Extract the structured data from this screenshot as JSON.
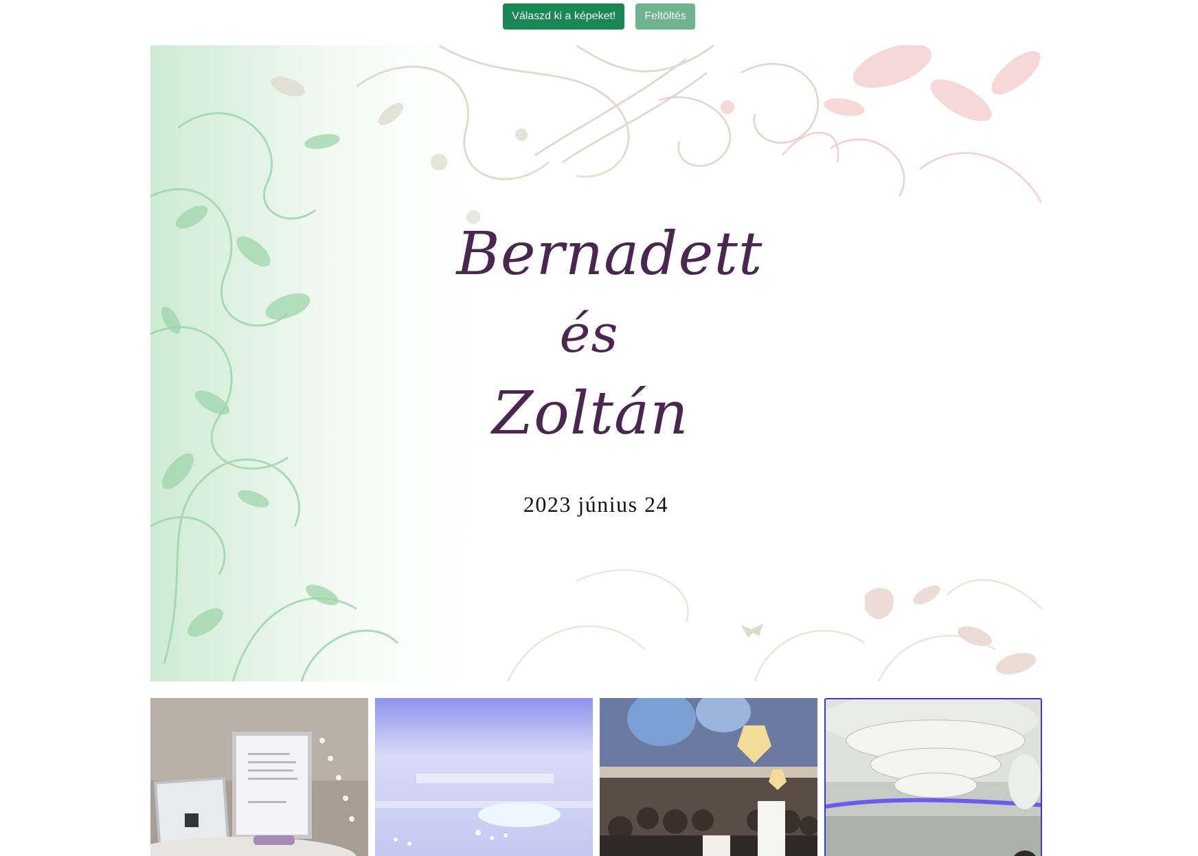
{
  "toolbar": {
    "choose_label": "Válaszd ki a képeket!",
    "upload_label": "Feltöltés"
  },
  "hero": {
    "name_bride": "Bernadett",
    "name_and": "és",
    "name_groom": "Zoltán",
    "date": "2023 június 24"
  },
  "gallery": {
    "photos": [
      {
        "subject": "guestbook-table-photo",
        "selected": false
      },
      {
        "subject": "ceiling-lights-photo",
        "selected": false
      },
      {
        "subject": "cake-cutting-photo",
        "selected": false
      },
      {
        "subject": "chandelier-photo",
        "selected": true
      }
    ]
  },
  "colors": {
    "primary_button": "#198754",
    "secondary_button": "#6fb48f",
    "name_text": "#4a2750",
    "selection_border": "#3a3ad0"
  }
}
